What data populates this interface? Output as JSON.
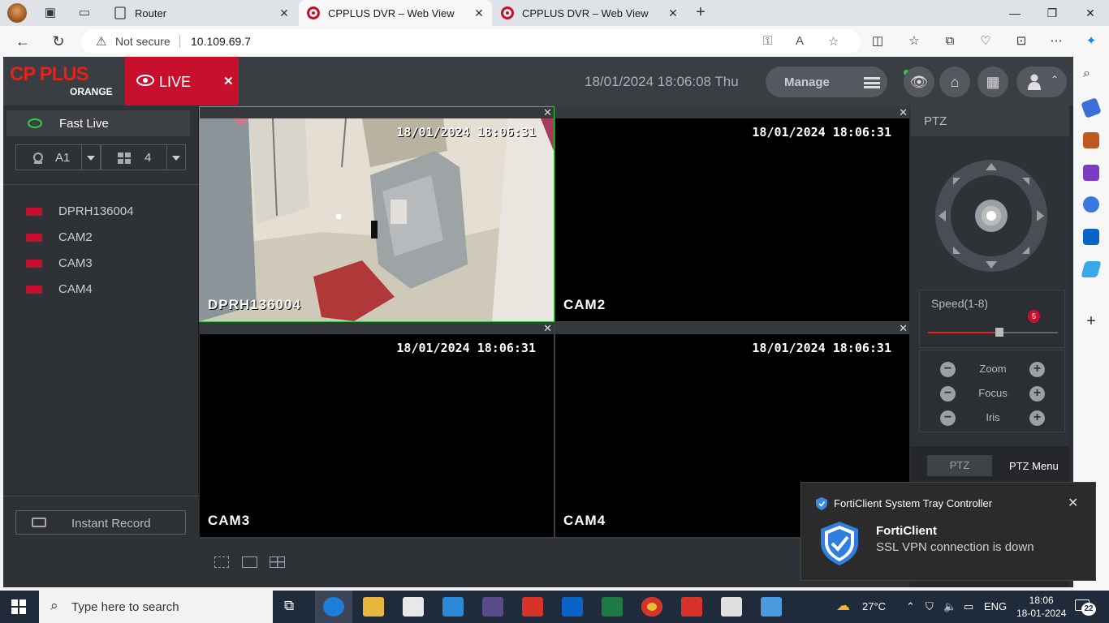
{
  "browser": {
    "tabs": [
      {
        "label": "Router",
        "active": false
      },
      {
        "label": "CPPLUS DVR – Web View",
        "active": true
      },
      {
        "label": "CPPLUS DVR – Web View",
        "active": false
      }
    ],
    "address": {
      "security_label": "Not secure",
      "url": "10.109.69.7"
    }
  },
  "dvr": {
    "logo_text": "CP PLUS",
    "logo_sub": "ORANGE",
    "live_label": "LIVE",
    "datetime": "18/01/2024 18:06:08 Thu",
    "manage_label": "Manage",
    "left": {
      "fast_live": "Fast Live",
      "channel_select": "A1",
      "split_select": "4",
      "cameras": [
        "DPRH136004",
        "CAM2",
        "CAM3",
        "CAM4"
      ],
      "instant_record": "Instant Record"
    },
    "panes": [
      {
        "name": "DPRH136004",
        "timestamp": "18/01/2024 18:06:31",
        "selected": true
      },
      {
        "name": "CAM2",
        "timestamp": "18/01/2024 18:06:31",
        "selected": false
      },
      {
        "name": "CAM3",
        "timestamp": "18/01/2024 18:06:31",
        "selected": false
      },
      {
        "name": "CAM4",
        "timestamp": "18/01/2024 18:06:31",
        "selected": false
      }
    ],
    "ptz": {
      "title": "PTZ",
      "speed_label": "Speed(1-8)",
      "speed_value": "5",
      "zoom_label": "Zoom",
      "focus_label": "Focus",
      "iris_label": "Iris",
      "tab_ptz": "PTZ",
      "tab_menu": "PTZ Menu"
    }
  },
  "toast": {
    "app": "FortiClient System Tray Controller",
    "title": "FortiClient",
    "message": "SSL VPN connection is down"
  },
  "taskbar": {
    "search_placeholder": "Type here to search",
    "weather": "27°C",
    "language": "ENG",
    "time": "18:06",
    "date": "18-01-2024",
    "notification_count": "22"
  },
  "colors": {
    "brand_red": "#c8102e",
    "selected_border": "#2ecc40",
    "app_bg": "#2b2e33"
  }
}
